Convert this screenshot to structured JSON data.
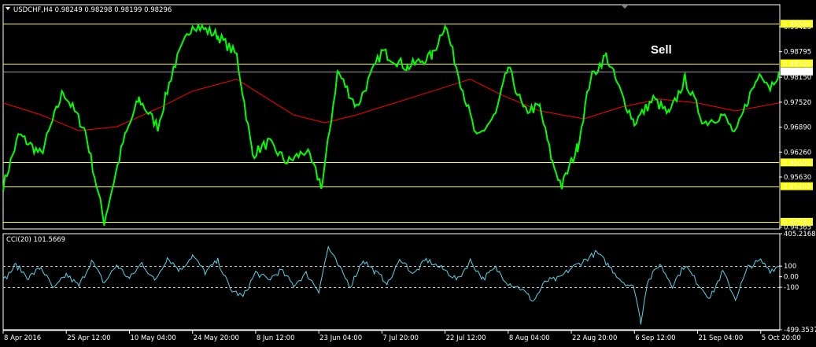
{
  "colors": {
    "background": "#000000",
    "price_line": "#00ff00",
    "moving_average": "#ff0000",
    "level_line": "#ffff00",
    "cci_line": "#5fd3e6",
    "frame": "#ffffff"
  },
  "header": {
    "menu_icon": "triangle-down-icon",
    "title": "USDCHF,H4  0.98249 0.98298 0.98199 0.98296"
  },
  "annotation": {
    "text": "Sell"
  },
  "chart_data": [
    {
      "type": "line",
      "title": "USDCHF,H4  0.98249 0.98298 0.98199 0.98296",
      "symbol": "USDCHF",
      "timeframe": "H4",
      "ohlc_last": {
        "open": 0.98249,
        "high": 0.98298,
        "low": 0.98199,
        "close": 0.98296
      },
      "ylim": [
        0.9432,
        0.9998
      ],
      "y_ticks": [
        "0.99425",
        "0.98795",
        "0.98150",
        "0.97520",
        "0.96890",
        "0.96260",
        "0.95630",
        "0.94365"
      ],
      "current_price_label": "0.98296",
      "levels": [
        {
          "value": 0.995,
          "label": "0.99500"
        },
        {
          "value": 0.985,
          "label": "0.98500"
        },
        {
          "value": 0.96,
          "label": "0.96000"
        },
        {
          "value": 0.954,
          "label": "0.95400"
        },
        {
          "value": 0.945,
          "label": "0.94500"
        }
      ],
      "current_price": 0.98296,
      "x_labels": [
        "8 Apr 2016",
        "25 Apr 12:00",
        "10 May 04:00",
        "24 May 20:00",
        "8 Jun 12:00",
        "23 Jun 04:00",
        "7 Jul 20:00",
        "22 Jul 12:00",
        "8 Aug 04:00",
        "22 Aug 20:00",
        "6 Sep 12:00",
        "21 Sep 04:00",
        "5 Oct 20:00"
      ],
      "x_label_index": [
        0,
        100,
        200,
        300,
        400,
        500,
        600,
        700,
        800,
        900,
        1000,
        1100,
        1200
      ],
      "bars_total": 1230,
      "series": [
        {
          "name": "USDCHF",
          "kind": "price",
          "points": [
            [
              0,
              0.954
            ],
            [
              25,
              0.967
            ],
            [
              60,
              0.962
            ],
            [
              95,
              0.978
            ],
            [
              130,
              0.968
            ],
            [
              160,
              0.945
            ],
            [
              190,
              0.965
            ],
            [
              215,
              0.976
            ],
            [
              245,
              0.969
            ],
            [
              270,
              0.984
            ],
            [
              300,
              0.995
            ],
            [
              340,
              0.992
            ],
            [
              370,
              0.987
            ],
            [
              395,
              0.962
            ],
            [
              420,
              0.965
            ],
            [
              450,
              0.96
            ],
            [
              480,
              0.963
            ],
            [
              505,
              0.954
            ],
            [
              530,
              0.983
            ],
            [
              560,
              0.974
            ],
            [
              600,
              0.988
            ],
            [
              640,
              0.984
            ],
            [
              680,
              0.987
            ],
            [
              700,
              0.995
            ],
            [
              725,
              0.98
            ],
            [
              750,
              0.966
            ],
            [
              780,
              0.972
            ],
            [
              800,
              0.984
            ],
            [
              825,
              0.973
            ],
            [
              850,
              0.974
            ],
            [
              870,
              0.96
            ],
            [
              885,
              0.954
            ],
            [
              910,
              0.964
            ],
            [
              930,
              0.981
            ],
            [
              955,
              0.987
            ],
            [
              980,
              0.977
            ],
            [
              1000,
              0.97
            ],
            [
              1030,
              0.976
            ],
            [
              1055,
              0.972
            ],
            [
              1080,
              0.981
            ],
            [
              1110,
              0.97
            ],
            [
              1140,
              0.972
            ],
            [
              1160,
              0.967
            ],
            [
              1180,
              0.976
            ],
            [
              1200,
              0.983
            ],
            [
              1215,
              0.979
            ],
            [
              1229,
              0.98296
            ]
          ]
        },
        {
          "name": "MA",
          "kind": "moving_average",
          "points": [
            [
              0,
              0.975
            ],
            [
              60,
              0.972
            ],
            [
              120,
              0.968
            ],
            [
              180,
              0.969
            ],
            [
              250,
              0.974
            ],
            [
              300,
              0.978
            ],
            [
              370,
              0.981
            ],
            [
              420,
              0.976
            ],
            [
              460,
              0.972
            ],
            [
              510,
              0.97
            ],
            [
              560,
              0.972
            ],
            [
              620,
              0.975
            ],
            [
              680,
              0.978
            ],
            [
              740,
              0.981
            ],
            [
              790,
              0.977
            ],
            [
              850,
              0.973
            ],
            [
              920,
              0.971
            ],
            [
              980,
              0.974
            ],
            [
              1040,
              0.976
            ],
            [
              1100,
              0.975
            ],
            [
              1160,
              0.973
            ],
            [
              1229,
              0.975
            ]
          ]
        }
      ]
    },
    {
      "type": "line",
      "title": "CCI(20) 101.5669",
      "indicator": "CCI(20)",
      "current_value": 101.5669,
      "ylim": [
        -499.3537,
        405.2168
      ],
      "y_ticks": [
        "405.2168",
        "100",
        "0.00",
        "-100",
        "-499.3537"
      ],
      "reference_levels": [
        100,
        -100
      ],
      "series": [
        {
          "name": "CCI(20)",
          "points": [
            [
              0,
              -40
            ],
            [
              20,
              110
            ],
            [
              40,
              -10
            ],
            [
              60,
              90
            ],
            [
              80,
              -120
            ],
            [
              100,
              20
            ],
            [
              120,
              -90
            ],
            [
              140,
              150
            ],
            [
              160,
              -60
            ],
            [
              180,
              110
            ],
            [
              200,
              -20
            ],
            [
              220,
              130
            ],
            [
              240,
              -40
            ],
            [
              260,
              180
            ],
            [
              280,
              60
            ],
            [
              300,
              200
            ],
            [
              320,
              40
            ],
            [
              340,
              150
            ],
            [
              360,
              -120
            ],
            [
              380,
              -190
            ],
            [
              400,
              40
            ],
            [
              420,
              -30
            ],
            [
              440,
              60
            ],
            [
              460,
              -80
            ],
            [
              480,
              30
            ],
            [
              500,
              -130
            ],
            [
              515,
              280
            ],
            [
              530,
              110
            ],
            [
              550,
              -90
            ],
            [
              570,
              160
            ],
            [
              590,
              40
            ],
            [
              610,
              -60
            ],
            [
              630,
              170
            ],
            [
              650,
              20
            ],
            [
              670,
              160
            ],
            [
              700,
              60
            ],
            [
              720,
              -30
            ],
            [
              740,
              150
            ],
            [
              760,
              -20
            ],
            [
              780,
              80
            ],
            [
              800,
              -60
            ],
            [
              820,
              -110
            ],
            [
              840,
              -230
            ],
            [
              860,
              -40
            ],
            [
              880,
              -20
            ],
            [
              900,
              80
            ],
            [
              920,
              150
            ],
            [
              940,
              230
            ],
            [
              960,
              100
            ],
            [
              980,
              -40
            ],
            [
              1000,
              -110
            ],
            [
              1010,
              -430
            ],
            [
              1020,
              -60
            ],
            [
              1040,
              120
            ],
            [
              1060,
              -80
            ],
            [
              1080,
              110
            ],
            [
              1100,
              -60
            ],
            [
              1120,
              -200
            ],
            [
              1140,
              50
            ],
            [
              1160,
              -210
            ],
            [
              1180,
              90
            ],
            [
              1200,
              150
            ],
            [
              1215,
              60
            ],
            [
              1229,
              101.57
            ]
          ]
        }
      ]
    }
  ]
}
